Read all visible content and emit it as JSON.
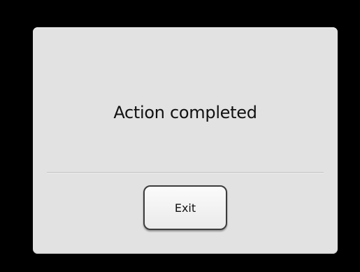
{
  "dialog": {
    "message": "Action completed",
    "exit_label": "Exit"
  },
  "colors": {
    "backdrop": "#000000",
    "dialog_background": "#e2e2e2",
    "button_border": "#3c3c3c"
  }
}
